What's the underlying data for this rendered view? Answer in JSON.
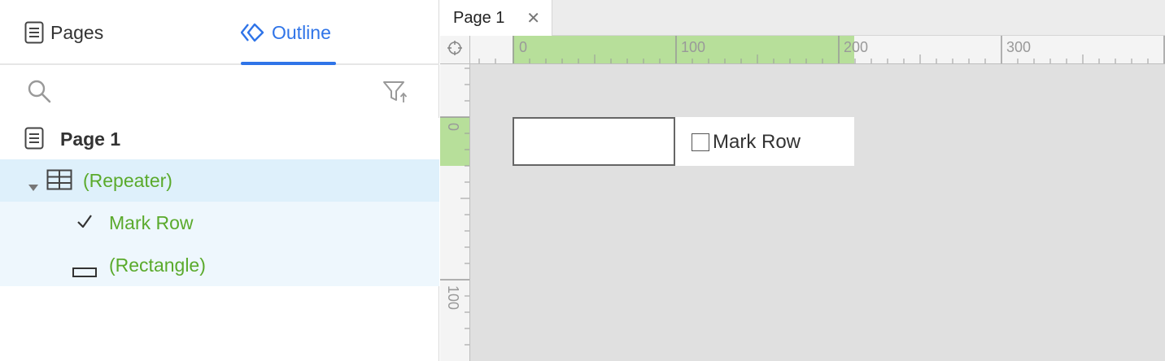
{
  "left_panel": {
    "tabs": {
      "pages_label": "Pages",
      "outline_label": "Outline"
    },
    "tree": {
      "page_label": "Page 1",
      "repeater_label": "(Repeater)",
      "mark_row_label": "Mark Row",
      "rectangle_label": "(Rectangle)"
    }
  },
  "document": {
    "tab_label": "Page 1",
    "close_glyph": "✕"
  },
  "rulers": {
    "horizontal_labels": [
      "0",
      "100",
      "200",
      "300"
    ],
    "vertical_labels": [
      "0",
      "100"
    ]
  },
  "canvas": {
    "checkbox_label": "Mark Row"
  },
  "colors": {
    "accent": "#2f74e8",
    "tree_widget_text": "#5aaa2c",
    "selected_row": "#def0fb",
    "ruler_highlight": "#b7df9a",
    "canvas_bg": "#e0e0e0"
  }
}
